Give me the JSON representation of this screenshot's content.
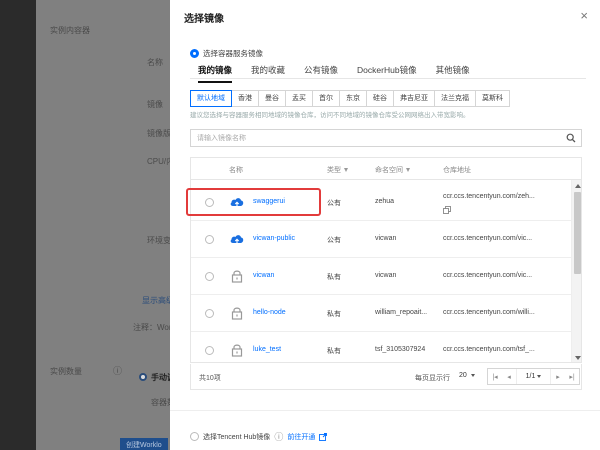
{
  "background": {
    "texts": [
      "实例内容器",
      "名称",
      "镜像",
      "镜像版",
      "CPU/内",
      "环境变",
      "显示高级",
      "注释：Wor",
      "实例数量",
      "手动调",
      "容器数",
      "创建Worklo"
    ]
  },
  "modal": {
    "title": "选择镜像",
    "close_label": "×",
    "source_option_label": "选择容器服务镜像",
    "tabs": [
      "我的镜像",
      "我的收藏",
      "公有镜像",
      "DockerHub镜像",
      "其他镜像"
    ],
    "active_tab": "我的镜像",
    "regions": [
      "默认地域",
      "香港",
      "曼谷",
      "孟买",
      "首尔",
      "东京",
      "硅谷",
      "弗吉尼亚",
      "法兰克福",
      "莫斯科"
    ],
    "active_region": "默认地域",
    "region_hint": "建议您选择与容器服务相同地域的镜像仓库，访问不同地域的镜像仓库受公网网络出入带宽影响。",
    "search_placeholder": "请输入镜像名称",
    "table": {
      "headers": {
        "name": "名称",
        "type": "类型",
        "namespace": "命名空间",
        "address": "仓库地址"
      },
      "rows": [
        {
          "name": "swaggerui",
          "type": "公有",
          "namespace": "zehua",
          "address": "ccr.ccs.tencentyun.com/zeh...",
          "icon": "cloud-upload-icon"
        },
        {
          "name": "vicwan-public",
          "type": "公有",
          "namespace": "vicwan",
          "address": "ccr.ccs.tencentyun.com/vic...",
          "icon": "cloud-upload-icon"
        },
        {
          "name": "vicwan",
          "type": "私有",
          "namespace": "vicwan",
          "address": "ccr.ccs.tencentyun.com/vic...",
          "icon": "lock-icon"
        },
        {
          "name": "hello-node",
          "type": "私有",
          "namespace": "william_repoait...",
          "address": "ccr.ccs.tencentyun.com/willi...",
          "icon": "lock-icon"
        },
        {
          "name": "luke_test",
          "type": "私有",
          "namespace": "tsf_3105307924",
          "address": "ccr.ccs.tencentyun.com/tsf_...",
          "icon": "lock-icon"
        }
      ]
    },
    "pagination": {
      "total": "共10项",
      "per_page_label": "每页显示行",
      "per_page": "20",
      "page": "1/1"
    },
    "footer": {
      "option_label": "选择Tencent Hub镜像",
      "link_label": "前往开通"
    }
  },
  "colors": {
    "accent": "#006eff",
    "highlight": "#e23b3b"
  }
}
